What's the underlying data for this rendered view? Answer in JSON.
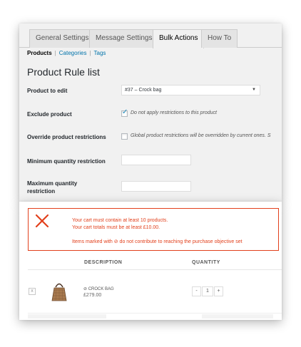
{
  "tabs": [
    {
      "label": "General Settings"
    },
    {
      "label": "Message Settings"
    },
    {
      "label": "Bulk Actions",
      "active": true
    },
    {
      "label": "How To"
    }
  ],
  "subnav": {
    "current": "Products",
    "links": [
      "Categories",
      "Tags"
    ],
    "separator": "|"
  },
  "page_title": "Product Rule list",
  "form": {
    "product_to_edit": {
      "label": "Product to edit",
      "value": "#37 –  Crock bag"
    },
    "exclude_product": {
      "label": "Exclude product",
      "checked": true,
      "description": "Do not apply restrictions to this product"
    },
    "override_restrictions": {
      "label": "Override product restrictions",
      "checked": false,
      "description": "Global product restrictions will be overridden by current ones. S"
    },
    "min_qty": {
      "label": "Minimum quantity restriction",
      "value": ""
    },
    "max_qty": {
      "label_line1": "Maximum quantity",
      "label_line2": "restriction",
      "value": ""
    }
  },
  "notice": {
    "line1": "Your cart must contain at least 10 products.",
    "line2": "Your cart totals must be at least £10.00.",
    "line3": "Items marked with ⊘ do not contribute to reaching the purchase objective set",
    "color": "#e2401c",
    "icon": "close-x-icon"
  },
  "cart": {
    "headers": {
      "description": "DESCRIPTION",
      "quantity": "QUANTITY"
    },
    "items": [
      {
        "remove": "x",
        "name": "⊘ CROCK BAG",
        "price": "£279.00",
        "quantity": "1",
        "minus": "-",
        "plus": "+"
      }
    ]
  },
  "colors": {
    "link": "#0073aa",
    "checkbox": "#1e8cbe",
    "error": "#e2401c"
  }
}
